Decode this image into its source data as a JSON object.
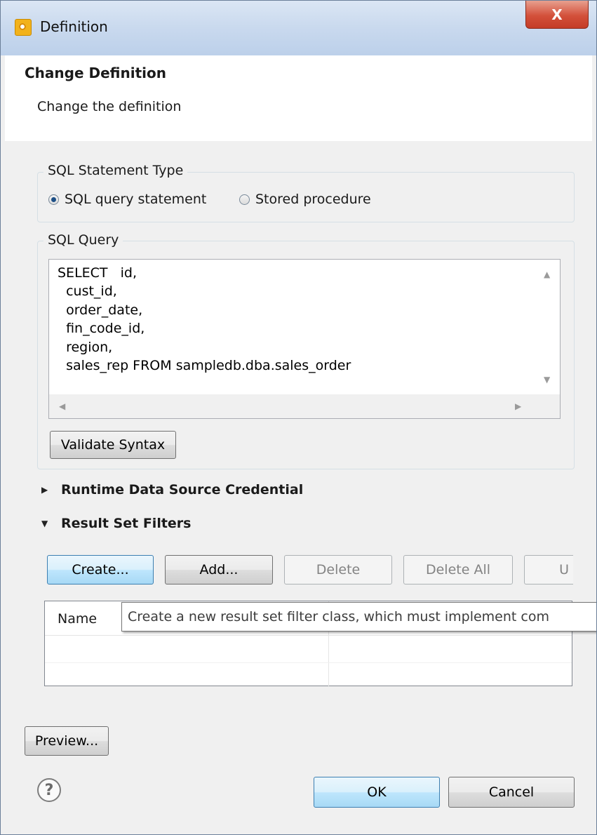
{
  "window": {
    "title": "Definition",
    "close_label": "X"
  },
  "header": {
    "title": "Change Definition",
    "description": "Change the definition"
  },
  "statement_type": {
    "label": "SQL Statement Type",
    "options": [
      {
        "label": "SQL query statement",
        "selected": true
      },
      {
        "label": "Stored procedure",
        "selected": false
      }
    ]
  },
  "sql_query": {
    "label": "SQL Query",
    "lines": [
      "SELECT   id,",
      "  cust_id,",
      "  order_date,",
      "  fin_code_id,",
      "  region,",
      "  sales_rep FROM sampledb.dba.sales_order"
    ],
    "validate_label": "Validate Syntax"
  },
  "sections": {
    "runtime_credential": "Runtime Data Source Credential",
    "result_set_filters": "Result Set Filters"
  },
  "filters_toolbar": {
    "create": "Create...",
    "add": "Add...",
    "delete": "Delete",
    "delete_all": "Delete All",
    "partial": "U"
  },
  "filters_table": {
    "columns": [
      "Name"
    ]
  },
  "tooltip": "Create a new result set filter class, which must implement com",
  "footer": {
    "preview": "Preview...",
    "ok": "OK",
    "cancel": "Cancel",
    "help_icon": "help-icon"
  }
}
